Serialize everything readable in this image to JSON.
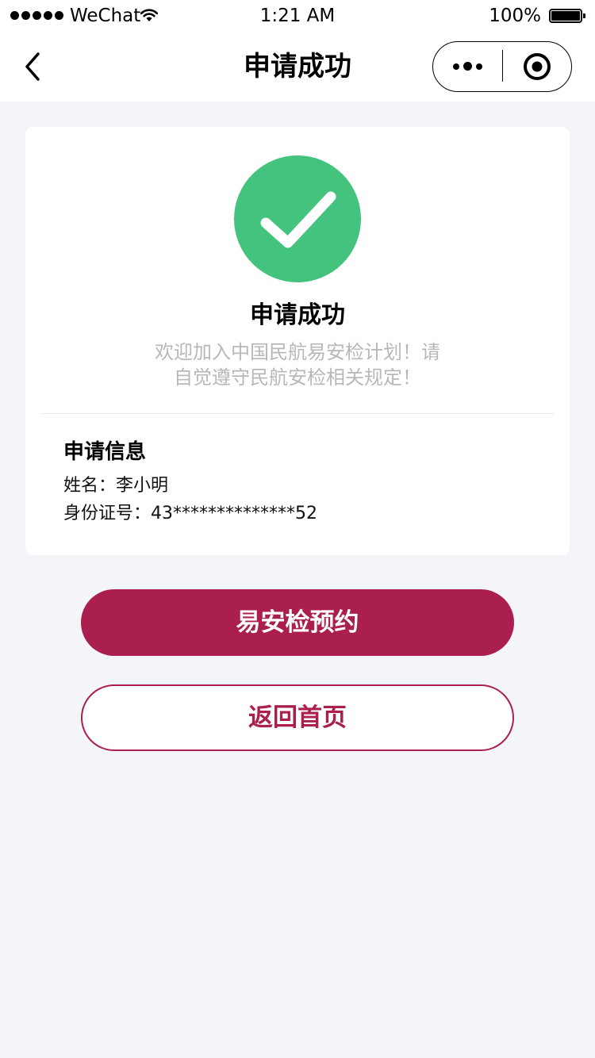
{
  "status_bar": {
    "carrier": "WeChat",
    "time": "1:21 AM",
    "battery": "100%",
    "signal_icon": "signal-dots-icon",
    "wifi_icon": "wifi-icon",
    "battery_icon": "battery-icon"
  },
  "nav": {
    "title": "申请成功",
    "back_icon": "chevron-left-icon",
    "more_icon": "more-dots-icon",
    "close_icon": "target-circle-icon"
  },
  "result": {
    "icon": "check-circle-icon",
    "title": "申请成功",
    "description_line1": "欢迎加入中国民航易安检计划！请",
    "description_line2": "自觉遵守民航安检相关规定！"
  },
  "info": {
    "section_title": "申请信息",
    "name_label": "姓名：",
    "name_value": "李小明",
    "id_label": "身份证号：",
    "id_value": "43**************52"
  },
  "actions": {
    "primary_label": "易安检预约",
    "secondary_label": "返回首页"
  },
  "colors": {
    "accent": "#ab1f4f",
    "success": "#43c37d",
    "page_background": "#f4f5f8",
    "muted_text": "#b8b8b8"
  }
}
